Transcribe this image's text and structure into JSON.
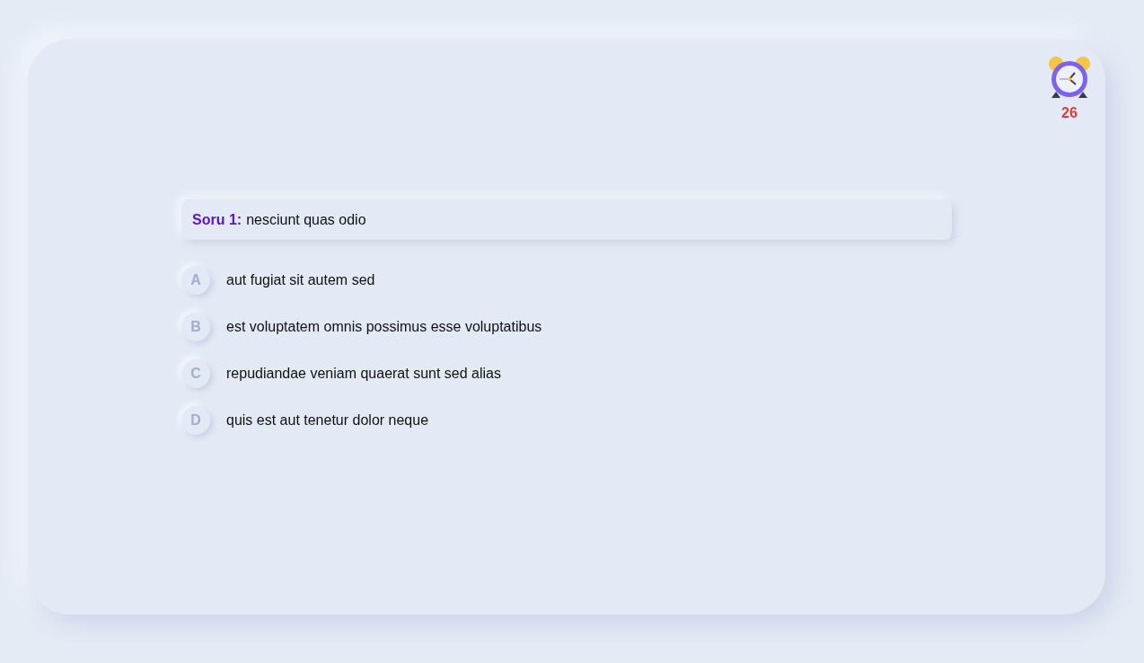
{
  "timer": {
    "seconds": "26"
  },
  "question": {
    "label": "Soru 1:",
    "text": "nesciunt quas odio"
  },
  "options": [
    {
      "letter": "A",
      "text": "aut fugiat sit autem sed"
    },
    {
      "letter": "B",
      "text": "est voluptatem omnis possimus esse voluptatibus"
    },
    {
      "letter": "C",
      "text": "repudiandae veniam quaerat sunt sed alias"
    },
    {
      "letter": "D",
      "text": "quis est aut tenetur dolor neque"
    }
  ]
}
